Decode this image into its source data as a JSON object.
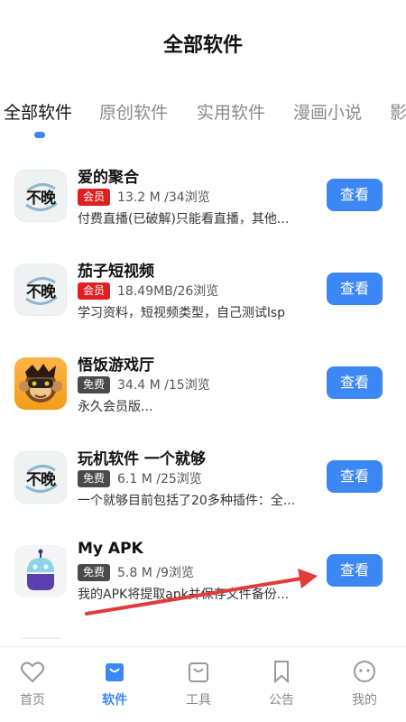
{
  "header": {
    "title": "全部软件"
  },
  "tabs": [
    {
      "label": "全部软件",
      "active": true
    },
    {
      "label": "原创软件",
      "active": false
    },
    {
      "label": "实用软件",
      "active": false
    },
    {
      "label": "漫画小说",
      "active": false
    },
    {
      "label": "影",
      "active": false
    }
  ],
  "items": [
    {
      "name": "爱的聚合",
      "badge": "会员",
      "badge_type": "vip",
      "meta": "13.2 M /34浏览",
      "desc": "付费直播(已破解)只能看直播，其他...",
      "button": "查看",
      "icon": "buwan-logo-icon",
      "icon_text": "不晚"
    },
    {
      "name": "茄子短视频",
      "badge": "会员",
      "badge_type": "vip",
      "meta": "18.49MB/26浏览",
      "desc": "学习资料，短视频类型，自己测试lsp",
      "button": "查看",
      "icon": "buwan-logo-icon",
      "icon_text": "不晚"
    },
    {
      "name": "悟饭游戏厅",
      "badge": "免费",
      "badge_type": "free",
      "meta": "34.4 M /15浏览",
      "desc": "永久会员版...",
      "button": "查看",
      "icon": "monkey-gamepad-icon"
    },
    {
      "name": "玩机软件 一个就够",
      "badge": "免费",
      "badge_type": "free",
      "meta": "6.1 M /25浏览",
      "desc": "一个就够目前包括了20多种插件：全...",
      "button": "查看",
      "icon": "buwan-logo-icon",
      "icon_text": "不晚"
    },
    {
      "name": "My APK",
      "badge": "免费",
      "badge_type": "free",
      "meta": "5.8 M /9浏览",
      "desc": "我的APK将提取apk并保存文件备份...",
      "button": "查看",
      "icon": "android-robot-icon"
    }
  ],
  "bottom_nav": [
    {
      "label": "首页",
      "icon": "heart-icon",
      "active": false
    },
    {
      "label": "软件",
      "icon": "shopping-bag-icon",
      "active": true
    },
    {
      "label": "工具",
      "icon": "bag-outline-icon",
      "active": false
    },
    {
      "label": "公告",
      "icon": "bookmark-icon",
      "active": false
    },
    {
      "label": "我的",
      "icon": "face-icon",
      "active": false
    }
  ],
  "colors": {
    "accent": "#3d87f5",
    "vip_badge": "#e02020",
    "free_badge": "#4a4a4a",
    "arrow": "#e23b3b"
  }
}
